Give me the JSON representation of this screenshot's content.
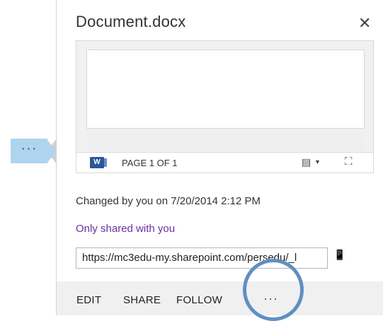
{
  "panel": {
    "title": "Document.docx",
    "close_glyph": "✕",
    "tab_ellipsis": "···"
  },
  "preview": {
    "page_label": "PAGE 1 OF 1",
    "word_icon_letter": "W",
    "viewer_icon": "▤",
    "caret": "▼",
    "expand_icon": "⛶"
  },
  "info": {
    "changed": "Changed by you on 7/20/2014 2:12 PM",
    "shared": "Only shared with you",
    "url": "https://mc3edu-my.sharepoint.com/persedu/_l",
    "copy_icon": "📱"
  },
  "footer": {
    "edit": "EDIT",
    "share": "SHARE",
    "follow": "FOLLOW",
    "more": "···"
  },
  "colors": {
    "accent": "#aed4ef",
    "shared_link": "#6b2fa0",
    "highlight": "#5f8fc2"
  }
}
